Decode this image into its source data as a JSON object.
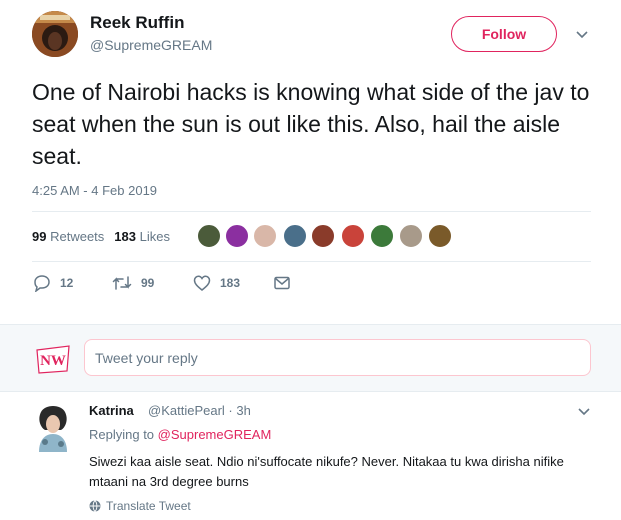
{
  "tweet": {
    "author_name": "Reek Ruffin",
    "author_handle": "@SupremeGREAM",
    "follow_label": "Follow",
    "text": "One of Nairobi hacks is knowing what side of the jav to seat when the sun is out like this. Also, hail the aisle seat.",
    "timestamp": "4:25 AM - 4 Feb 2019",
    "retweets_count": "99",
    "retweets_label": "Retweets",
    "likes_count": "183",
    "likes_label": "Likes",
    "likers_avatar_count": 9,
    "actions": {
      "reply_count": "12",
      "retweet_count": "99",
      "like_count": "183"
    },
    "colors": {
      "accent": "#e0245e",
      "muted": "#657786",
      "text": "#14171a",
      "divider": "#e6ecf0"
    }
  },
  "reply_composer": {
    "placeholder": "Tweet your reply",
    "logo_text": "NW"
  },
  "reply": {
    "name": "Katrina",
    "handle": "@KattiePearl",
    "age": "· 3h",
    "replying_prefix": "Replying to",
    "replying_to": "@SupremeGREAM",
    "text": "Siwezi kaa aisle seat. Ndio ni'suffocate nikufe? Never. Nitakaa tu kwa dirisha nifike mtaani na 3rd degree burns",
    "translate_label": "Translate Tweet"
  }
}
